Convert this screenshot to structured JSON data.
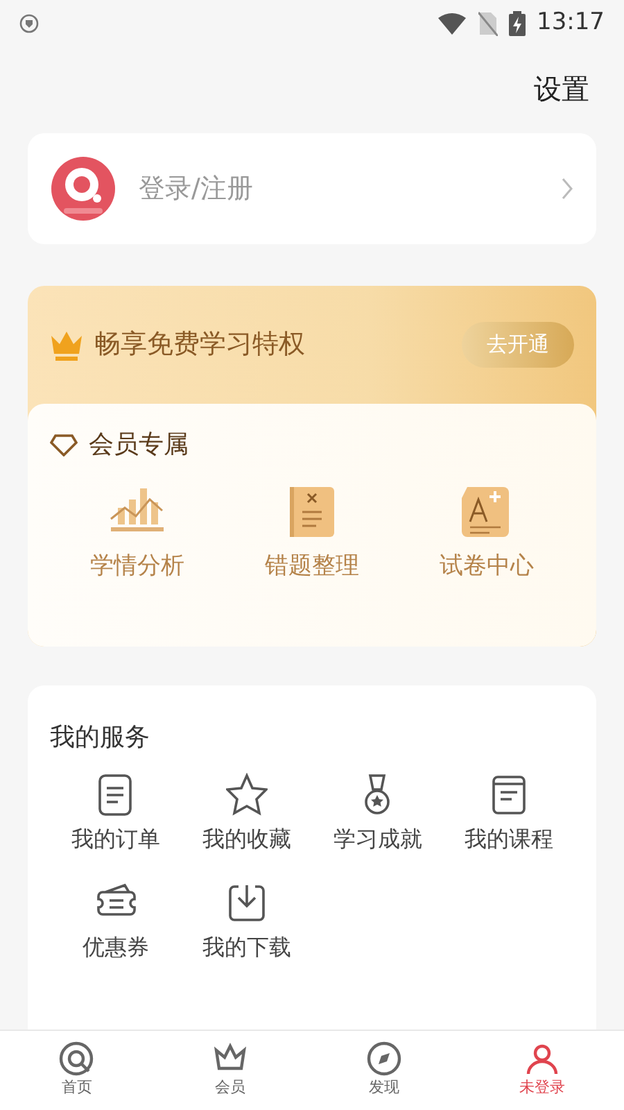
{
  "status_bar": {
    "time": "13:17"
  },
  "header": {
    "settings": "设置"
  },
  "login": {
    "label": "登录/注册"
  },
  "vip_banner": {
    "title": "畅享免费学习特权",
    "button": "去开通"
  },
  "member": {
    "title": "会员专属",
    "items": [
      {
        "kind": "chart",
        "label": "学情分析"
      },
      {
        "kind": "mistakes",
        "label": "错题整理"
      },
      {
        "kind": "exam",
        "label": "试卷中心"
      }
    ]
  },
  "services": {
    "title": "我的服务",
    "items": [
      {
        "kind": "order",
        "label": "我的订单"
      },
      {
        "kind": "star",
        "label": "我的收藏"
      },
      {
        "kind": "medal",
        "label": "学习成就"
      },
      {
        "kind": "course",
        "label": "我的课程"
      },
      {
        "kind": "coupon",
        "label": "优惠券"
      },
      {
        "kind": "download",
        "label": "我的下载"
      }
    ]
  },
  "bottom_nav": [
    {
      "kind": "home",
      "label": "首页",
      "selected": false
    },
    {
      "kind": "vip",
      "label": "会员",
      "selected": false
    },
    {
      "kind": "discover",
      "label": "发现",
      "selected": false
    },
    {
      "kind": "me",
      "label": "未登录",
      "selected": true
    }
  ]
}
